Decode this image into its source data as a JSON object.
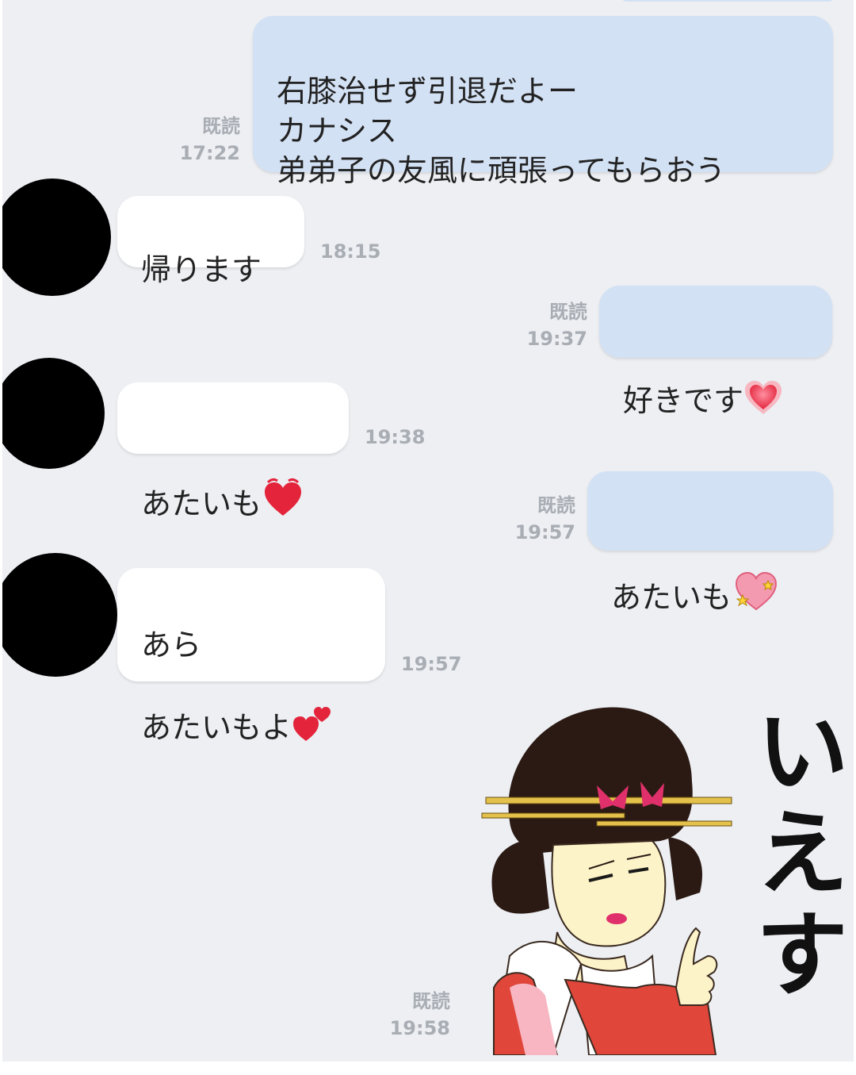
{
  "messages": [
    {
      "side": "me",
      "text": "右膝治せず引退だよー\nカナシス\n弟弟子の友風に頑張ってもらおう",
      "read": "既読",
      "time": "17:22"
    },
    {
      "side": "them",
      "text": "帰ります",
      "time": "18:15"
    },
    {
      "side": "me",
      "text": "好きです",
      "emoji": "sparkling-heart-emoji",
      "read": "既読",
      "time": "19:37"
    },
    {
      "side": "them",
      "text": "あたいも",
      "emoji": "beating-heart-emoji",
      "time": "19:38"
    },
    {
      "side": "me",
      "text": "あたいも",
      "emoji": "sparkle-heart-emoji",
      "read": "既読",
      "time": "19:57"
    },
    {
      "side": "them",
      "text": "あら\nあたいもよ",
      "emoji": "two-hearts-emoji",
      "time": "19:57"
    },
    {
      "side": "me",
      "type": "sticker",
      "sticker_text": "いえす",
      "read": "既読",
      "time": "19:58"
    }
  ],
  "colors": {
    "background": "#edeff3",
    "my_bubble": "#d3e1f4",
    "their_bubble": "#ffffff",
    "meta_text": "#a9adb4",
    "heart": "#e3243b",
    "kimono": "#e0463a"
  }
}
